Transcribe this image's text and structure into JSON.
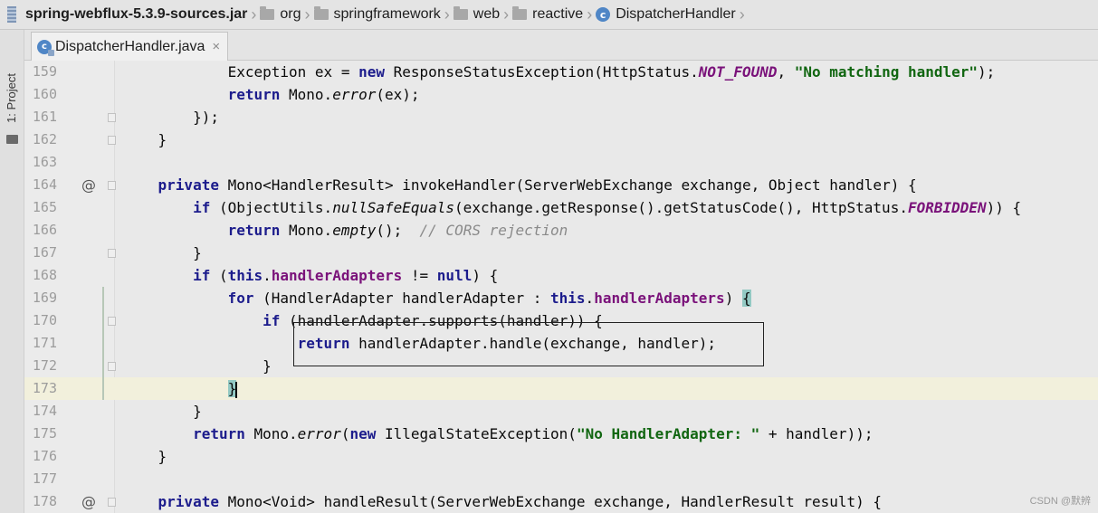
{
  "breadcrumb": {
    "jar": "spring-webflux-5.3.9-sources.jar",
    "packages": [
      "org",
      "springframework",
      "web",
      "reactive"
    ],
    "class_name": "DispatcherHandler"
  },
  "toolstrip": {
    "project_label": "1: Project"
  },
  "tab": {
    "title": "DispatcherHandler.java",
    "close": "×",
    "icon_letter": "c"
  },
  "lines": [
    {
      "n": "159",
      "html": "            Exception ex = <span class='kw'>new</span> ResponseStatusException(HttpStatus.<span class='cst'>NOT_FOUND</span>, <span class='str'>\"No matching handler\"</span>);"
    },
    {
      "n": "160",
      "html": "            <span class='kw'>return</span> Mono.<span class='itl'>error</span>(ex);"
    },
    {
      "n": "161",
      "html": "        });"
    },
    {
      "n": "162",
      "html": "    }"
    },
    {
      "n": "163",
      "html": ""
    },
    {
      "n": "164",
      "html": "    <span class='kw'>private</span> Mono&lt;HandlerResult&gt; invokeHandler(ServerWebExchange exchange, Object handler) {"
    },
    {
      "n": "165",
      "html": "        <span class='kw'>if</span> (ObjectUtils.<span class='itl'>nullSafeEquals</span>(exchange.getResponse().getStatusCode(), HttpStatus.<span class='cst'>FORBIDDEN</span>)) {"
    },
    {
      "n": "166",
      "html": "            <span class='kw'>return</span> Mono.<span class='itl'>empty</span>();  <span class='cmt'>// CORS rejection</span>"
    },
    {
      "n": "167",
      "html": "        }"
    },
    {
      "n": "168",
      "html": "        <span class='kw'>if</span> (<span class='kw'>this</span>.<span class='fld'>handlerAdapters</span> != <span class='kw'>null</span>) {"
    },
    {
      "n": "169",
      "html": "            <span class='kw'>for</span> (HandlerAdapter handlerAdapter : <span class='kw'>this</span>.<span class='fld'>handlerAdapters</span>) <span class='brace-hl'>{</span>"
    },
    {
      "n": "170",
      "html": "                <span class='kw'>if</span> (handlerAdapter.supports(handler)) {"
    },
    {
      "n": "171",
      "html": "                    <span class='kw'>return</span> handlerAdapter.handle(exchange, handler);"
    },
    {
      "n": "172",
      "html": "                }"
    },
    {
      "n": "173",
      "html": "            <span class='brace-hl'>}</span><span class='cursor'></span>"
    },
    {
      "n": "174",
      "html": "        }"
    },
    {
      "n": "175",
      "html": "        <span class='kw'>return</span> Mono.<span class='itl'>error</span>(<span class='kw'>new</span> IllegalStateException(<span class='str'>\"No HandlerAdapter: \"</span> + handler));"
    },
    {
      "n": "176",
      "html": "    }"
    },
    {
      "n": "177",
      "html": ""
    },
    {
      "n": "178",
      "html": "    <span class='kw'>private</span> Mono&lt;Void&gt; handleResult(ServerWebExchange exchange, HandlerResult result) {"
    }
  ],
  "override_marker": "@",
  "current_line": "173",
  "watermark": "CSDN @默辨"
}
